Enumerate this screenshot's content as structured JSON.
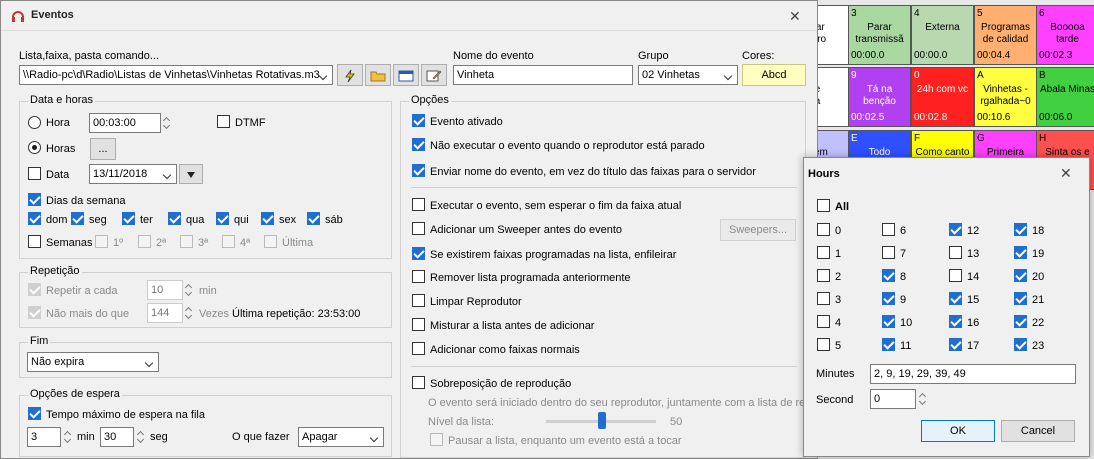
{
  "background_grid": {
    "cells": [
      {
        "num": "",
        "name": "gar\nntro",
        "time": "0"
      },
      {
        "num": "3",
        "name": "Parar\ntransmissã",
        "time": "00:00.0",
        "color": "#a8d8a0"
      },
      {
        "num": "4",
        "name": "Externa",
        "time": "00:00.0",
        "color": "#b8d8b0"
      },
      {
        "num": "5",
        "name": "Programas\nde calidad",
        "time": "00:04.4",
        "color": "#ffb070"
      },
      {
        "num": "6",
        "name": "Booooa\ntarde",
        "time": "00:02.3",
        "color": "#ff40ff"
      },
      {
        "num": "",
        "name": "e\na",
        "time": "3",
        "color": "#fff"
      },
      {
        "num": "9",
        "name": "Tá na\nbenção",
        "time": "00:02.5",
        "color": "#b040f0"
      },
      {
        "num": "0",
        "name": "24h com vc",
        "time": "00:02.8",
        "color": "#ff2020"
      },
      {
        "num": "A",
        "name": "Vinhetas -\nrgalhada~0",
        "time": "00:10.6",
        "color": "#ffff40"
      },
      {
        "num": "B",
        "name": "Abala Minas",
        "time": "00:06.0",
        "color": "#40d040"
      },
      {
        "num": "",
        "name": "Sem",
        "time": "",
        "color": "#c0c0ff"
      },
      {
        "num": "E",
        "name": "Todo",
        "time": "",
        "color": "#3050ff"
      },
      {
        "num": "F",
        "name": "Como canto",
        "time": "",
        "color": "#ffff00"
      },
      {
        "num": "G",
        "name": "Primeira",
        "time": "",
        "color": "#ff40ff"
      },
      {
        "num": "H",
        "name": "Sinta os e",
        "time": "",
        "color": "#ff5050"
      }
    ]
  },
  "dialog": {
    "title": "Eventos",
    "close": "✕",
    "list_label": "Lista,faixa, pasta comando...",
    "list_value": "\\\\Radio-pc\\d\\Radio\\Listas de Vinhetas\\Vinhetas Rotativas.m3",
    "event_name_label": "Nome do evento",
    "event_name_value": "Vinheta",
    "group_label": "Grupo",
    "group_value": "02 Vinhetas",
    "colors_label": "Cores:",
    "colors_button": "Abcd",
    "date_hours": {
      "title": "Data e horas",
      "hora_label": "Hora",
      "hora_value": "00:03:00",
      "dtmf_label": "DTMF",
      "horas_label": "Horas",
      "horas_button": "...",
      "data_label": "Data",
      "data_value": "13/11/2018",
      "dias_label": "Dias da semana",
      "days": [
        "dom",
        "seg",
        "ter",
        "qua",
        "qui",
        "sex",
        "sáb"
      ],
      "semanas_label": "Semanas",
      "weeks": [
        "1º",
        "2ª",
        "3ª",
        "4ª",
        "Última"
      ]
    },
    "repeat": {
      "title": "Repetição",
      "every_label": "Repetir a cada",
      "every_value": "10",
      "every_unit": "min",
      "max_label": "Não mais do que",
      "max_value": "144",
      "max_unit": "Vezes",
      "last_label": "Última repetição: 23:53:00"
    },
    "end": {
      "title": "Fim",
      "value": "Não expira"
    },
    "wait": {
      "title": "Opções de espera",
      "max_wait_label": "Tempo máximo de espera na fila",
      "min_value": "3",
      "min_unit": "min",
      "sec_value": "30",
      "sec_unit": "seg",
      "action_label": "O que fazer",
      "action_value": "Apagar"
    },
    "options": {
      "title": "Opções",
      "items": [
        {
          "label": "Evento ativado",
          "checked": true
        },
        {
          "label": "Não executar o evento quando o reprodutor está parado",
          "checked": true
        },
        {
          "label": "Enviar nome do evento, em vez do título das faixas para o servidor",
          "checked": true
        },
        {
          "label": "Executar o evento, sem esperar o fim da faixa atual",
          "checked": false
        },
        {
          "label": "Adicionar um Sweeper antes do evento",
          "checked": false
        },
        {
          "label": "Se existirem faixas programadas na lista, enfileirar",
          "checked": true
        },
        {
          "label": "Remover lista programada anteriormente",
          "checked": false
        },
        {
          "label": "Limpar Reprodutor",
          "checked": false
        },
        {
          "label": "Misturar a lista antes de adicionar",
          "checked": false
        },
        {
          "label": "Adicionar como faixas normais",
          "checked": false
        }
      ],
      "sweepers_button": "Sweepers...",
      "overlap_label": "Sobreposição de reprodução",
      "overlap_desc": "O evento será iniciado dentro do seu reprodutor, juntamente com a lista de re",
      "level_label": "Nível da lista:",
      "level_value": "50",
      "pause_label": "Pausar a lista, enquanto um evento está a tocar"
    }
  },
  "hours_dialog": {
    "title": "Hours",
    "close": "✕",
    "all_label": "All",
    "hours": [
      {
        "h": "0",
        "c": false
      },
      {
        "h": "1",
        "c": false
      },
      {
        "h": "2",
        "c": false
      },
      {
        "h": "3",
        "c": false
      },
      {
        "h": "4",
        "c": false
      },
      {
        "h": "5",
        "c": false
      },
      {
        "h": "6",
        "c": false
      },
      {
        "h": "7",
        "c": false
      },
      {
        "h": "8",
        "c": true
      },
      {
        "h": "9",
        "c": true
      },
      {
        "h": "10",
        "c": true
      },
      {
        "h": "11",
        "c": true
      },
      {
        "h": "12",
        "c": true
      },
      {
        "h": "13",
        "c": false
      },
      {
        "h": "14",
        "c": false
      },
      {
        "h": "15",
        "c": true
      },
      {
        "h": "16",
        "c": true
      },
      {
        "h": "17",
        "c": true
      },
      {
        "h": "18",
        "c": true
      },
      {
        "h": "19",
        "c": true
      },
      {
        "h": "20",
        "c": true
      },
      {
        "h": "21",
        "c": true
      },
      {
        "h": "22",
        "c": true
      },
      {
        "h": "23",
        "c": true
      }
    ],
    "minutes_label": "Minutes",
    "minutes_value": "2, 9, 19, 29, 39, 49",
    "second_label": "Second",
    "second_value": "0",
    "ok_label": "OK",
    "cancel_label": "Cancel"
  }
}
